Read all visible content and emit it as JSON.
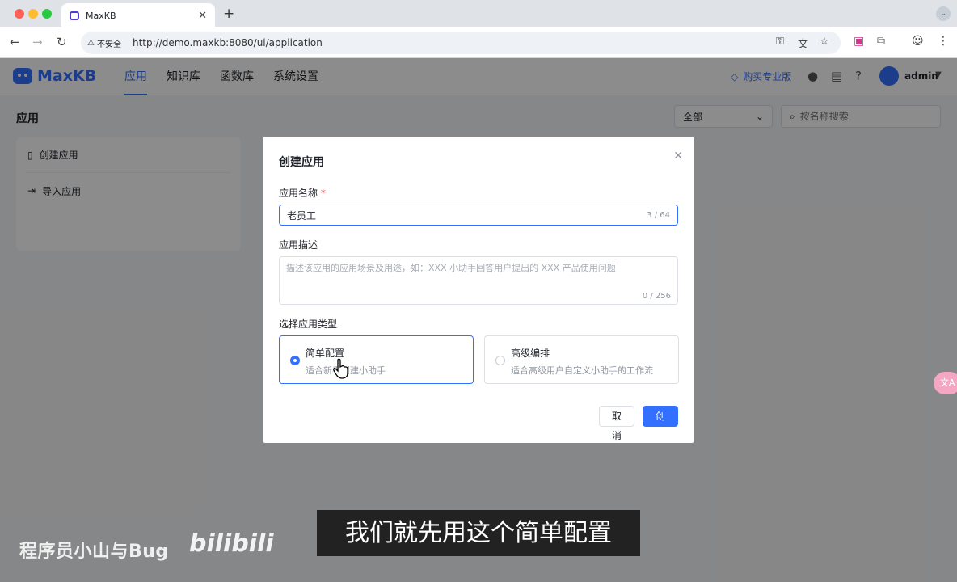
{
  "browser": {
    "tab_title": "MaxKB",
    "security_label": "不安全",
    "url": "http://demo.maxkb:8080/ui/application"
  },
  "app": {
    "logo_text": "MaxKB",
    "nav": [
      "应用",
      "知识库",
      "函数库",
      "系统设置"
    ],
    "active_nav": "应用",
    "buy_pro": "购买专业版",
    "username": "admin",
    "page_title": "应用",
    "filter_value": "全部",
    "search_placeholder": "按名称搜索",
    "actions": [
      "创建应用",
      "导入应用"
    ],
    "accent_color": "#3370ff"
  },
  "dialog": {
    "title": "创建应用",
    "name_label": "应用名称",
    "name_required_mark": "*",
    "name_value": "老员工",
    "name_counter": "3 / 64",
    "desc_label": "应用描述",
    "desc_placeholder": "描述该应用的应用场景及用途，如：XXX 小助手回答用户提出的 XXX 产品使用问题",
    "desc_counter": "0 / 256",
    "type_label": "选择应用类型",
    "types": [
      {
        "title": "简单配置",
        "desc": "适合新手创建小助手",
        "selected": true
      },
      {
        "title": "高级编排",
        "desc": "适合高级用户自定义小助手的工作流",
        "selected": false
      }
    ],
    "cancel_label": "取消",
    "create_label": "创建"
  },
  "video": {
    "subtitle": "我们就先用这个简单配置",
    "channel_watermark": "程序员小山与Bug",
    "platform_logo": "bilibili"
  }
}
